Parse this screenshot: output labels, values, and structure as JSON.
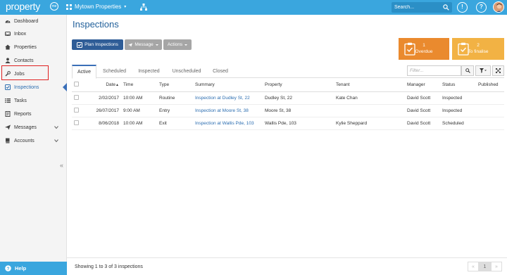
{
  "topbar": {
    "logo": "property",
    "logo_me": "me",
    "account": "Mytown Properties",
    "search_placeholder": "Search...",
    "notif_label": "!",
    "help_label": "?"
  },
  "sidebar": {
    "items": [
      {
        "label": "Dashboard",
        "icon": "dashboard-icon"
      },
      {
        "label": "Inbox",
        "icon": "inbox-icon"
      },
      {
        "label": "Properties",
        "icon": "home-icon"
      },
      {
        "label": "Contacts",
        "icon": "person-icon"
      },
      {
        "label": "Jobs",
        "icon": "wrench-icon"
      },
      {
        "label": "Inspections",
        "icon": "checkbox-icon"
      },
      {
        "label": "Tasks",
        "icon": "list-icon"
      },
      {
        "label": "Reports",
        "icon": "report-icon"
      },
      {
        "label": "Messages",
        "icon": "send-icon"
      },
      {
        "label": "Accounts",
        "icon": "book-icon"
      }
    ],
    "collapse": "«",
    "help": "Help"
  },
  "page": {
    "title": "Inspections",
    "buttons": {
      "plan": "Plan Inspections",
      "message": "Message",
      "actions": "Actions"
    },
    "stats": [
      {
        "count": "1",
        "label": "Overdue"
      },
      {
        "count": "2",
        "label": "To finalise"
      }
    ],
    "tabs": [
      "Active",
      "Scheduled",
      "Inspected",
      "Unscheduled",
      "Closed"
    ],
    "filter_placeholder": "Filter..."
  },
  "table": {
    "headers": [
      "Date",
      "Time",
      "Type",
      "Summary",
      "Property",
      "Tenant",
      "Manager",
      "Status",
      "Published"
    ],
    "sort_indicator": "▲",
    "rows": [
      {
        "date": "2/02/2017",
        "time": "10:00 AM",
        "type": "Routine",
        "summary": "Inspection at Dudley St, 22",
        "property": "Dudley St, 22",
        "tenant": "Kate Chan",
        "manager": "David Scott",
        "status": "Inspected",
        "published": ""
      },
      {
        "date": "26/07/2017",
        "time": "9:00 AM",
        "type": "Entry",
        "summary": "Inspection at Moore St, 38",
        "property": "Moore St, 38",
        "tenant": "",
        "manager": "David Scott",
        "status": "Inspected",
        "published": ""
      },
      {
        "date": "8/06/2018",
        "time": "10:00 AM",
        "type": "Exit",
        "summary": "Inspection at Wallis Pde, 103",
        "property": "Wallis Pde, 103",
        "tenant": "Kylie Sheppard",
        "manager": "David Scott",
        "status": "Scheduled",
        "published": ""
      }
    ]
  },
  "footer": {
    "summary": "Showing 1 to 3 of 3 inspections",
    "prev": "«",
    "page": "1",
    "next": "»"
  },
  "colors": {
    "topbar": "#3aa6de",
    "primary": "#2f5d97",
    "overdue": "#ea8a2e",
    "finalise": "#f2b244",
    "link": "#2b6db0"
  }
}
